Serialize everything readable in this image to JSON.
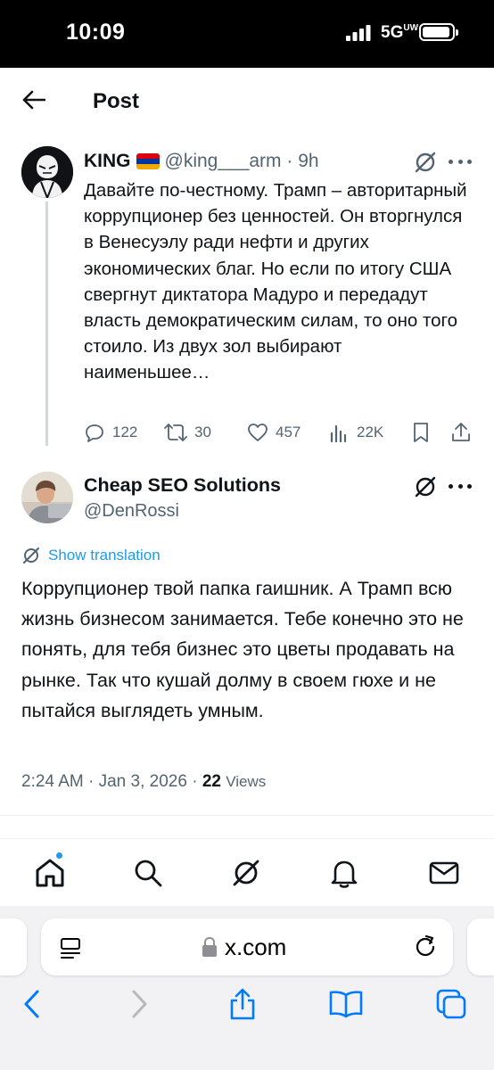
{
  "status_bar": {
    "time": "10:09",
    "network": "5G",
    "network_suffix": "UW"
  },
  "header": {
    "title": "Post"
  },
  "original_post": {
    "author_name": "KING",
    "handle": "@king___arm",
    "time_ago": "9h",
    "text": "Давайте по-честному. Трамп – авторитарный коррупционер без ценностей. Он вторгнулся в Венесуэлу ради нефти и других экономических благ. Но если по итогу США свергнут диктатора Мадуро и передадут власть демократическим силам, то оно того стоило. Из двух зол выбирают наименьшее…",
    "flag_colors": [
      "#d90012",
      "#0033a0",
      "#f2a800"
    ],
    "replies": "122",
    "reposts": "30",
    "likes": "457",
    "views": "22K"
  },
  "reply": {
    "author_name": "Cheap SEO Solutions",
    "handle": "@DenRossi",
    "show_translation": "Show translation",
    "text": "Коррупционер твой папка гаишник. А Трамп всю жизнь бизнесом занимается. Тебе конечно это не понять, для тебя бизнес это цветы продавать на рынке. Так что кушай долму в своем гюхе и не пытайся выглядеть умным.",
    "time": "2:24 AM",
    "date": "Jan 3, 2026",
    "views_count": "22",
    "views_label": "Views"
  },
  "tabbar": {
    "items": [
      "home-icon",
      "search-icon",
      "grok-icon",
      "notifications-icon",
      "messages-icon"
    ],
    "home_has_dot": true
  },
  "safari": {
    "url": "x.com",
    "accent": "#007aff"
  },
  "colors": {
    "text_primary": "#0f1419",
    "text_secondary": "#536471",
    "link_blue": "#1d9bf0"
  }
}
